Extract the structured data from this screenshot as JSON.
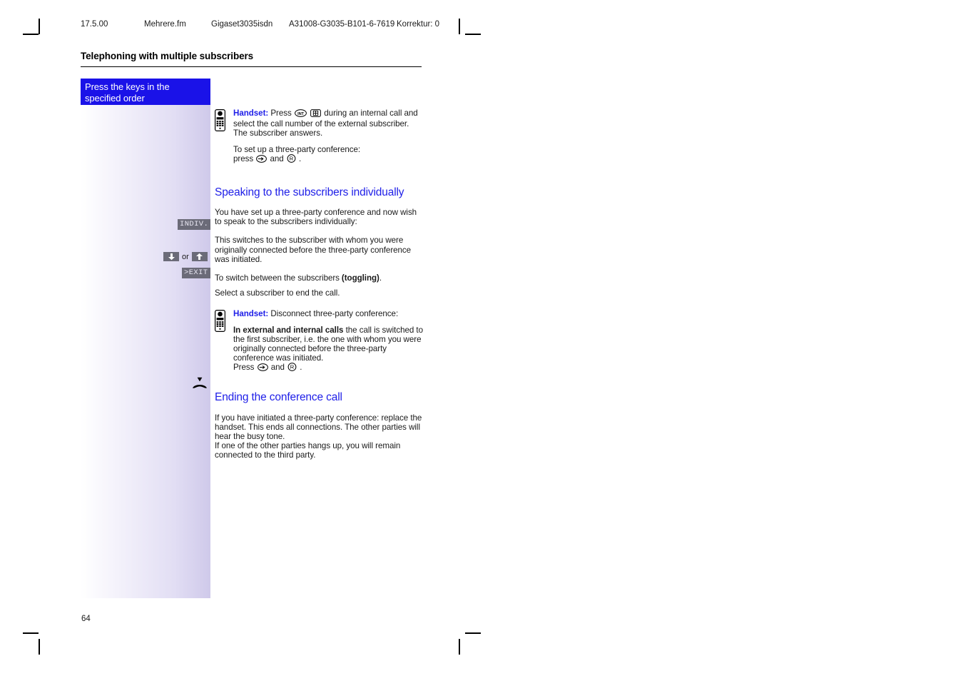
{
  "print_header": {
    "date": "17.5.00",
    "filename": "Mehrere.fm",
    "product": "Gigaset3035isdn",
    "doc_number": "A31008-G3035-B101-6-7619",
    "correction": "Korrektur: 0"
  },
  "running_head": "Telephoning with multiple subscribers",
  "left_column": {
    "blue_box_line1": "Press the keys in the",
    "blue_box_line2": "specified order",
    "softkeys": {
      "indiv": "INDIV.",
      "exit": ">EXIT",
      "or": "or",
      "down_icon": "arrow-down-icon",
      "up_icon": "arrow-up-icon"
    },
    "hangup_icon": "hangup-handset-icon"
  },
  "content": {
    "instruction_1": {
      "icon": "cordless-handset-icon",
      "label": "Handset:",
      "text_before_keys": "Press",
      "key_int": "INT",
      "key_keypad": "keypad-icon",
      "text_after_keys": "during an internal call and select the call number of the external subscriber. The subscriber answers.",
      "second_para_line1": "To set up a three-party conference:",
      "second_para_line2_before": "press",
      "second_para_key1": "transfer-arrow-icon",
      "second_para_and": "and",
      "second_para_key2": "R",
      "second_para_end": "."
    },
    "section_1_title": "Speaking to the subscribers individually",
    "section_1_para_1": "You have set up a three-party conference and now wish to speak to the subscribers individually:",
    "section_1_para_2": "This switches to the subscriber with whom you were originally connected before the three-party conference was initiated.",
    "section_1_para_3_before": "To switch between the subscribers",
    "section_1_para_3_bold": "(toggling)",
    "section_1_para_3_after": ".",
    "section_1_para_4": "Select a subscriber to end the call.",
    "instruction_2": {
      "icon": "cordless-handset-icon",
      "label": "Handset:",
      "text": "Disconnect three-party conference:",
      "bold_lead": "In external and internal calls",
      "body": "the call is switched to the first subscriber, i.e. the one with whom you were originally connected before the three-party conference was initiated.",
      "press_line_before": "Press",
      "press_key1": "transfer-arrow-icon",
      "press_and": "and",
      "press_key2": "R",
      "press_end": "."
    },
    "section_2_title": "Ending the conference call",
    "section_2_para_1": "If you have initiated a three-party conference: replace the handset. This ends all connections. The other parties will hear the busy tone.",
    "section_2_para_2": "If one of the other parties hangs up, you will remain connected to the third party."
  },
  "page_number": "64",
  "colors": {
    "heading_blue": "#2020e8",
    "box_blue": "#1a12e8",
    "softkey_gray": "#6b6b78",
    "margin_lavender": "#cfc9ea"
  }
}
